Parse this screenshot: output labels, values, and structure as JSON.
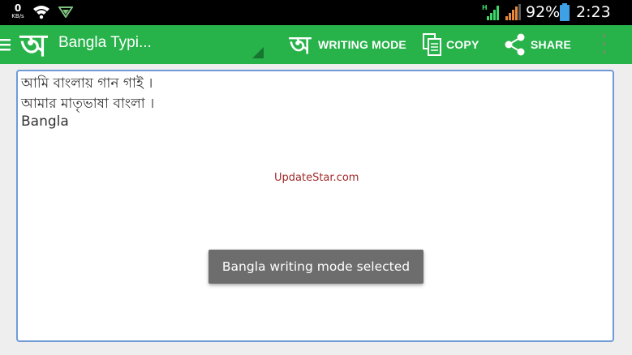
{
  "status_bar": {
    "net_speed_value": "0",
    "net_speed_unit": "KB/s",
    "network_type": "H",
    "battery_percent": "92%",
    "time": "2:23 AM",
    "time_short": "2:23"
  },
  "action_bar": {
    "logo_glyph": "অ",
    "title": "Bangla Typi...",
    "actions": {
      "writing_mode_glyph": "অ",
      "writing_mode_label": "WRITING MODE",
      "copy_label": "COPY",
      "share_label": "SHARE"
    }
  },
  "editor": {
    "lines": [
      "আমি বাংলায় গান গাই ।",
      "আমার মাতৃভাষা বাংলা ।",
      "Bangla"
    ]
  },
  "watermark": "UpdateStar.com",
  "toast": {
    "message": "Bangla writing mode selected"
  },
  "colors": {
    "action_bar": "#27b24a",
    "status_bar": "#000000",
    "editor_border": "#6f9ad8",
    "toast_bg": "#6d6d6d",
    "watermark": "#a12a2a"
  }
}
